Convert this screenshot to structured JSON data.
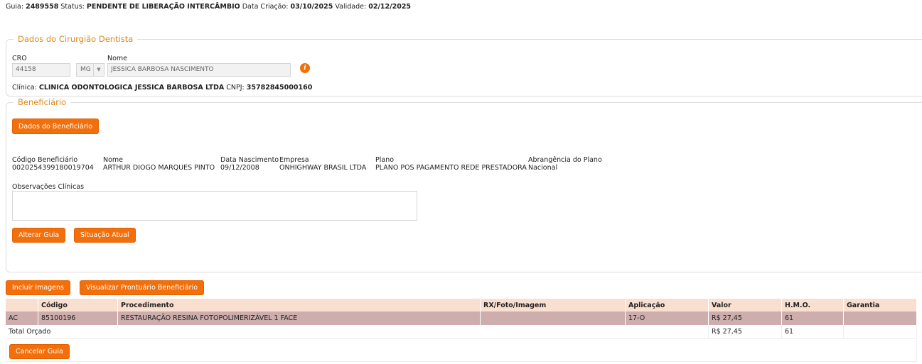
{
  "header": {
    "guia_label": "Guia:",
    "guia_value": "2489558",
    "status_label": "Status:",
    "status_value": "PENDENTE DE LIBERAÇÃO INTERCÂMBIO",
    "criacao_label": "Data Criação:",
    "criacao_value": "03/10/2025",
    "validade_label": "Validade:",
    "validade_value": "02/12/2025"
  },
  "dentista": {
    "legend": "Dados do Cirurgião Dentista",
    "cro_label": "CRO",
    "cro_value": "44158",
    "uf_value": "MG",
    "nome_label": "Nome",
    "nome_value": "JESSICA BARBOSA NASCIMENTO",
    "clinica_label": "Clínica:",
    "clinica_value": "CLINICA ODONTOLOGICA JESSICA BARBOSA LTDA",
    "cnpj_label": "CNPJ:",
    "cnpj_value": "35782845000160",
    "info_icon": "info-icon"
  },
  "beneficiario": {
    "legend": "Beneficiário",
    "dados_button": "Dados do Beneficiário",
    "fields": [
      {
        "label": "Código Beneficiário",
        "value": "0020254399180019704"
      },
      {
        "label": "Nome",
        "value": "ARTHUR DIOGO MARQUES PINTO"
      },
      {
        "label": "Data Nascimento",
        "value": "09/12/2008"
      },
      {
        "label": "Empresa",
        "value": "ONHIGHWAY BRASIL LTDA"
      },
      {
        "label": "Plano",
        "value": "PLANO POS PAGAMENTO REDE PRESTADORA"
      },
      {
        "label": "Abrangência do Plano",
        "value": "Nacional"
      }
    ],
    "obs_label": "Observações Clínicas",
    "obs_value": "",
    "alterar_button": "Alterar Guia",
    "situacao_button": "Situação Atual"
  },
  "actions": {
    "incluir_button": "Incluir Imagens",
    "prontuario_button": "Visualizar Prontuário Beneficiário",
    "cancelar_button": "Cancelar Guia"
  },
  "table": {
    "headers": [
      "",
      "Código",
      "Procedimento",
      "RX/Foto/Imagem",
      "Aplicação",
      "Valor",
      "H.M.O.",
      "Garantia"
    ],
    "rows": [
      [
        "AC",
        "85100196",
        "RESTAURAÇÃO RESINA FOTOPOLIMERIZÁVEL 1 FACE",
        "",
        "17-O",
        "",
        "61",
        ""
      ]
    ],
    "total_label": "Total Orçado",
    "total_valor": "R$ 27,45",
    "total_hmo": "61"
  },
  "colors": {
    "accent": "#f36f0b",
    "legend": "#e08a1e",
    "header_row": "#f9dfcf",
    "selected_row": "#ceadad"
  }
}
